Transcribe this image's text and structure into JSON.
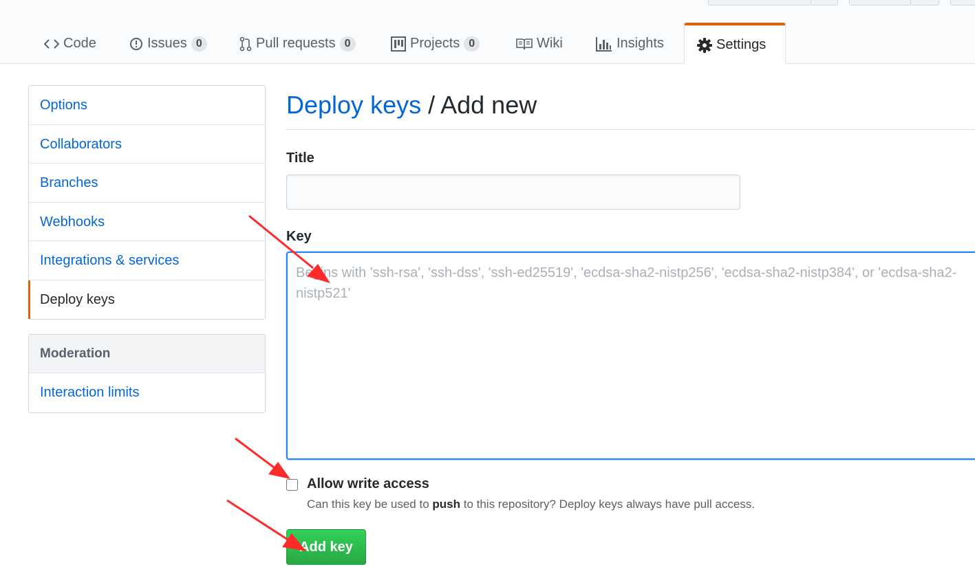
{
  "nav": {
    "tabs": [
      {
        "label": "Code",
        "icon": "code-icon"
      },
      {
        "label": "Issues",
        "count": "0",
        "icon": "issue-icon"
      },
      {
        "label": "Pull requests",
        "count": "0",
        "icon": "pull-request-icon"
      },
      {
        "label": "Projects",
        "count": "0",
        "icon": "project-icon"
      },
      {
        "label": "Wiki",
        "icon": "book-icon"
      },
      {
        "label": "Insights",
        "icon": "graph-icon"
      },
      {
        "label": "Settings",
        "icon": "gear-icon",
        "selected": true
      }
    ]
  },
  "sidebar": {
    "items": [
      "Options",
      "Collaborators",
      "Branches",
      "Webhooks",
      "Integrations & services",
      "Deploy keys"
    ],
    "selected": "Deploy keys",
    "moderation": {
      "heading": "Moderation",
      "items": [
        "Interaction limits"
      ]
    }
  },
  "page": {
    "title_link": "Deploy keys",
    "title_rest": " / Add new",
    "title_label": "Title",
    "key_label": "Key",
    "key_placeholder": "Begins with 'ssh-rsa', 'ssh-dss', 'ssh-ed25519', 'ecdsa-sha2-nistp256', 'ecdsa-sha2-nistp384', or 'ecdsa-sha2-nistp521'",
    "allow_write_label": "Allow write access",
    "note_prefix": "Can this key be used to ",
    "note_bold": "push",
    "note_suffix": " to this repository? Deploy keys always have pull access.",
    "add_button": "Add key"
  },
  "colors": {
    "link": "#0366d6",
    "accent": "#e36209",
    "primary_button": "#28a745",
    "annotation_arrow": "#ff2a2a"
  }
}
